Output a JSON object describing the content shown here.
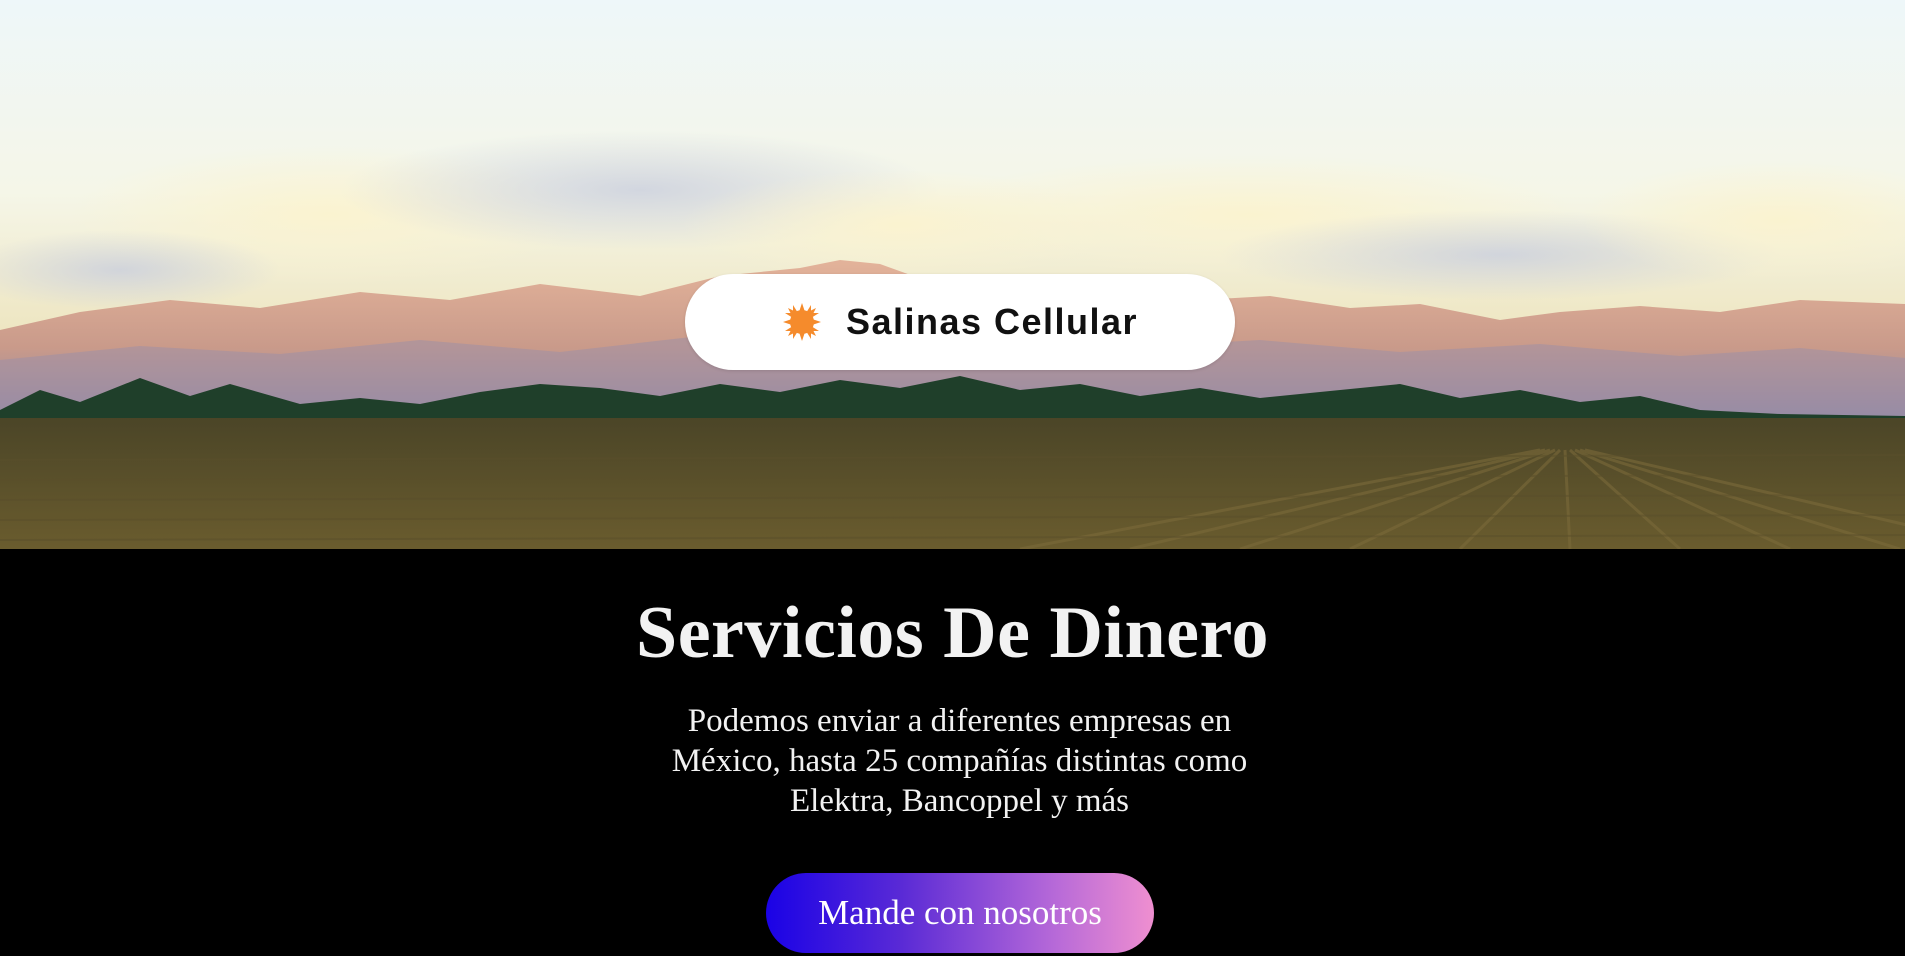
{
  "hero": {
    "brand": {
      "logo_icon": "sun-flower-icon",
      "logo_color": "#f58b2c",
      "name": "Salinas Cellular"
    }
  },
  "content": {
    "title": "Servicios De Dinero",
    "description": "Podemos enviar a diferentes empresas en México, hasta 25 compañías distintas como Elektra, Bancoppel y más",
    "cta_label": "Mande con nosotros",
    "cta_gradient": [
      "#1a02e6",
      "#ef8fd0"
    ]
  }
}
